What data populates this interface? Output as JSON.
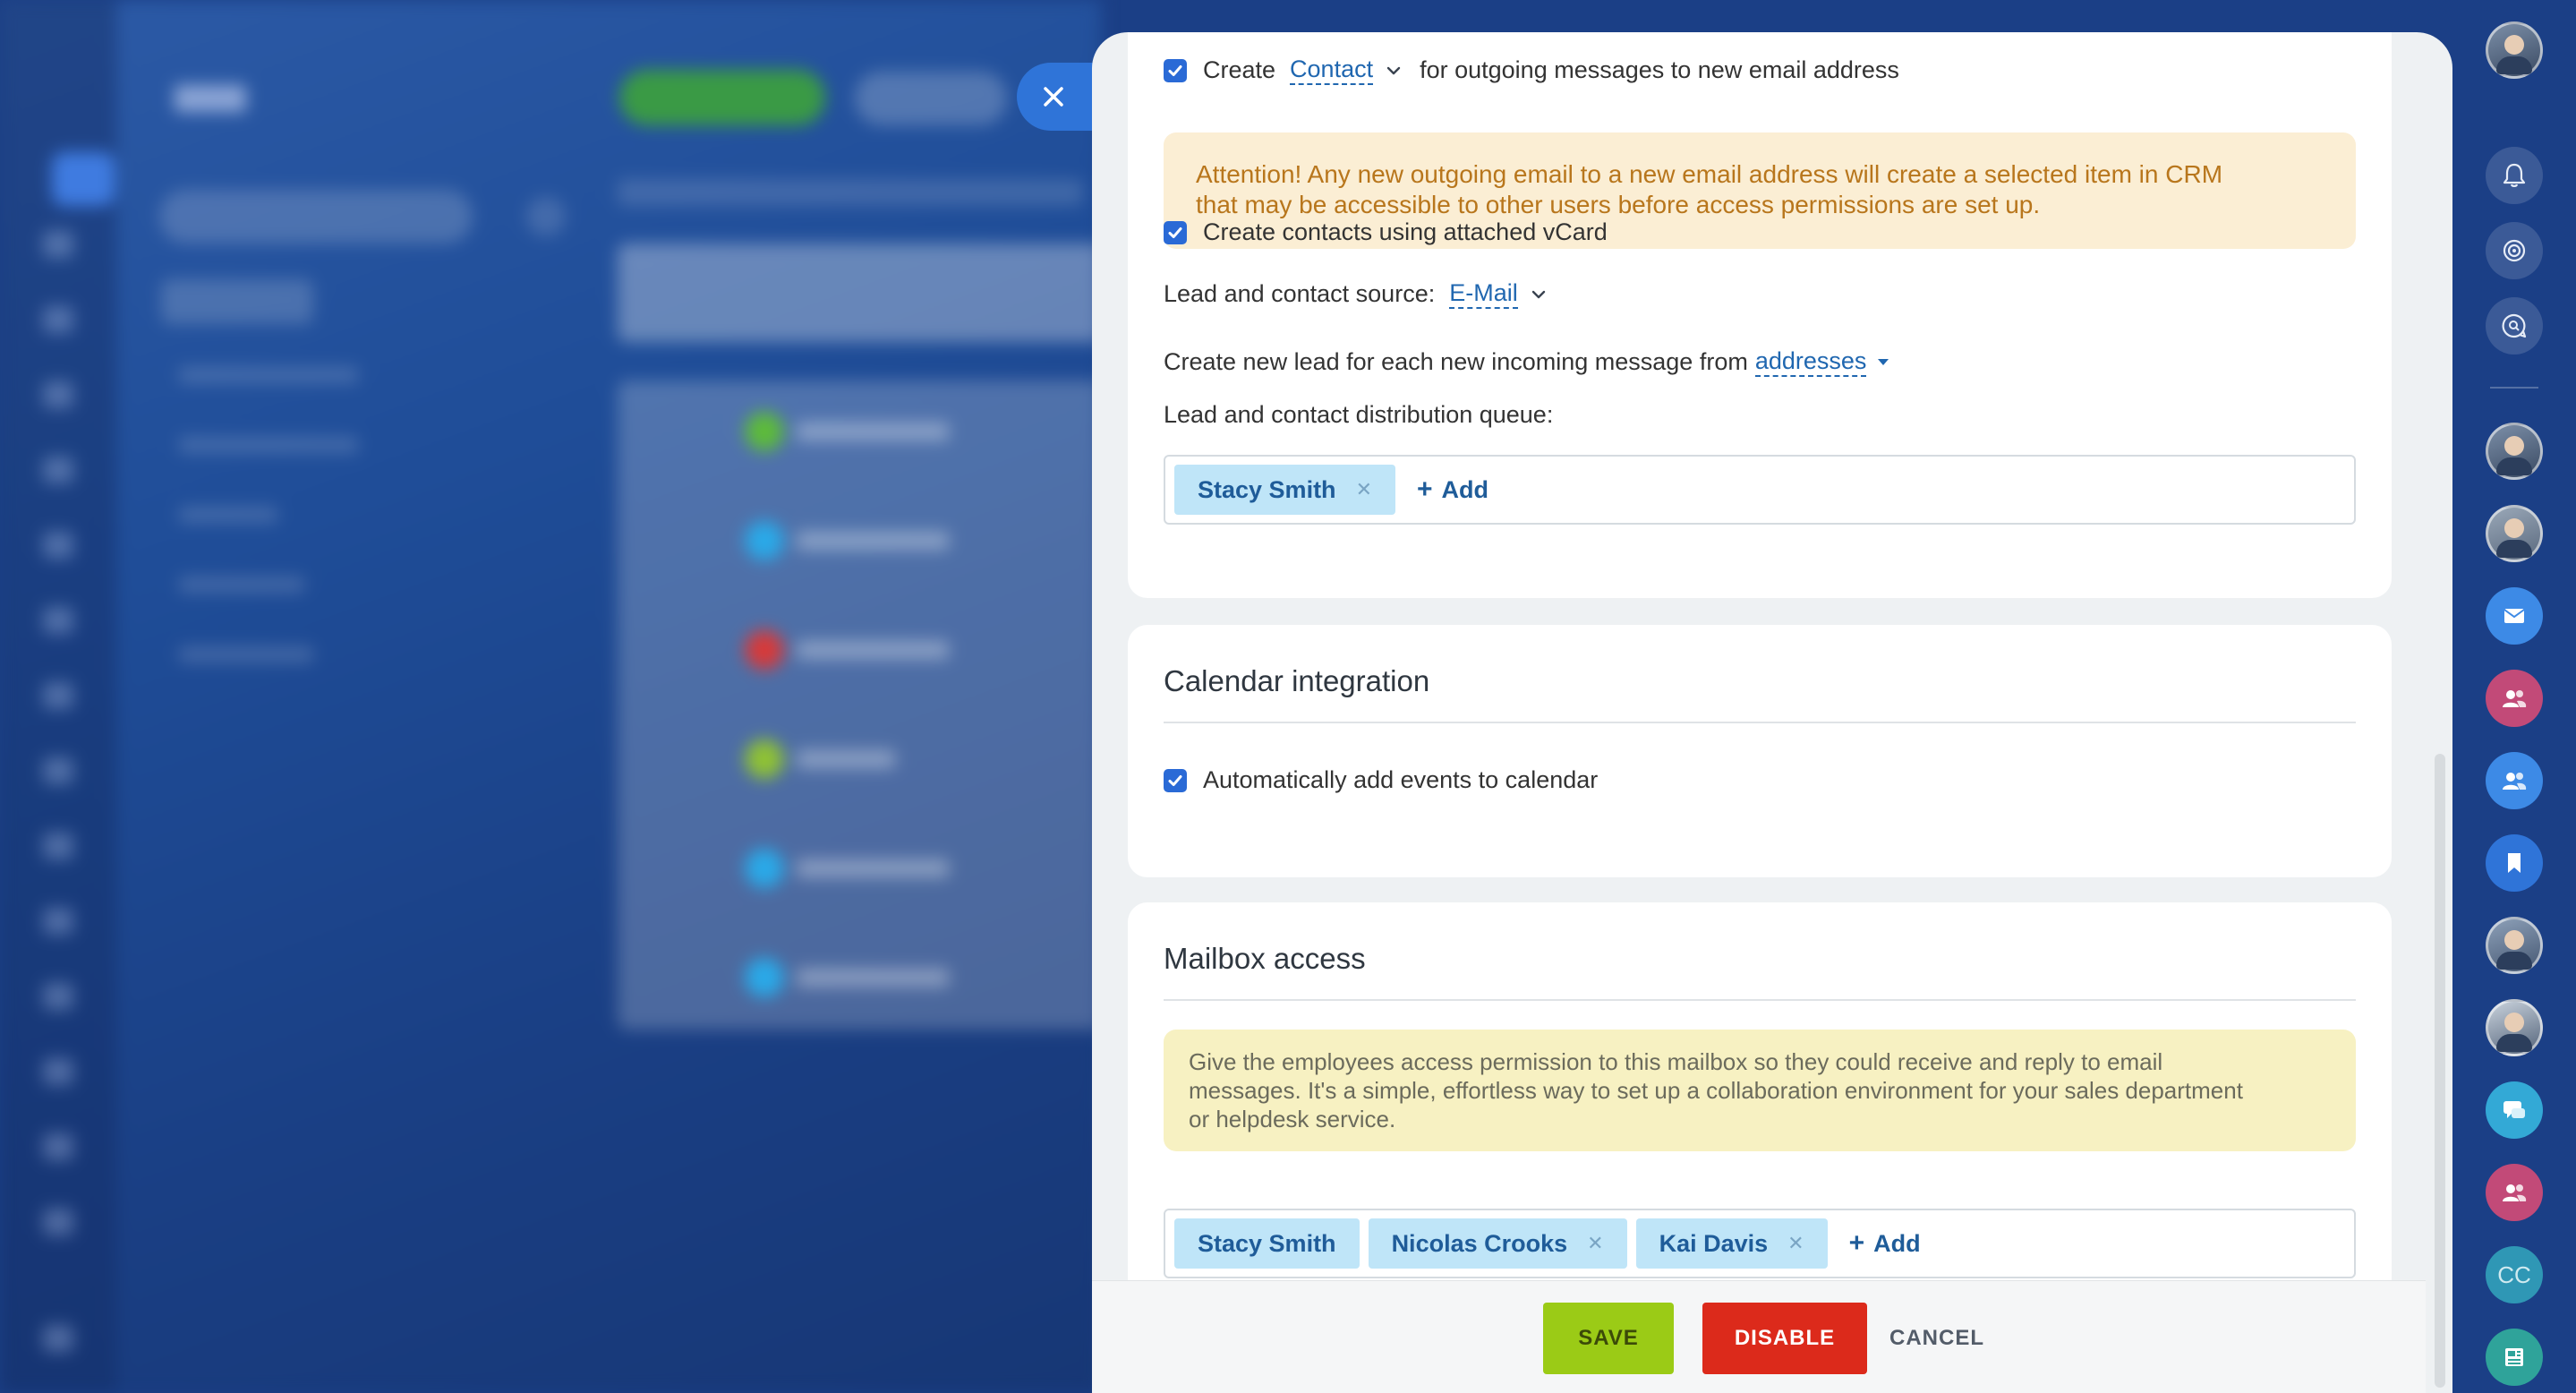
{
  "crm": {
    "create_label": "Create",
    "create_entity": "Contact",
    "create_suffix": "for outgoing messages to new email address",
    "attention_line1": "Attention! Any new outgoing email to a new email address will create a selected item in CRM",
    "attention_line2": "that may be accessible to other users before access permissions are set up.",
    "vcard_label": "Create contacts using attached vCard",
    "source_label": "Lead and contact source:",
    "source_value": "E-Mail",
    "new_lead_label": "Create new lead for each new incoming message from",
    "new_lead_value": "addresses",
    "queue_label": "Lead and contact distribution queue:",
    "queue_users": [
      "Stacy Smith"
    ],
    "add_label": "Add"
  },
  "calendar": {
    "title": "Calendar integration",
    "auto_add_label": "Automatically add events to calendar"
  },
  "mailbox": {
    "title": "Mailbox access",
    "info_line1": "Give the employees access permission to this mailbox so they could receive and reply to email",
    "info_line2": "messages. It's a simple, effortless way to set up a collaboration environment for your sales department",
    "info_line3": "or helpdesk service.",
    "users": [
      "Stacy Smith",
      "Nicolas Crooks",
      "Kai Davis"
    ],
    "add_label": "Add"
  },
  "footer": {
    "save": "SAVE",
    "disable": "DISABLE",
    "cancel": "CANCEL"
  },
  "rail": {
    "cc_initials": "CC"
  },
  "colors": {
    "accent_blue": "#2a6ad6",
    "save_green": "#9bcb16",
    "disable_red": "#dc2a1b",
    "attention_bg": "#fbeed4",
    "info_bg": "#f7f1c2",
    "chip_bg": "#bfe5f8"
  }
}
